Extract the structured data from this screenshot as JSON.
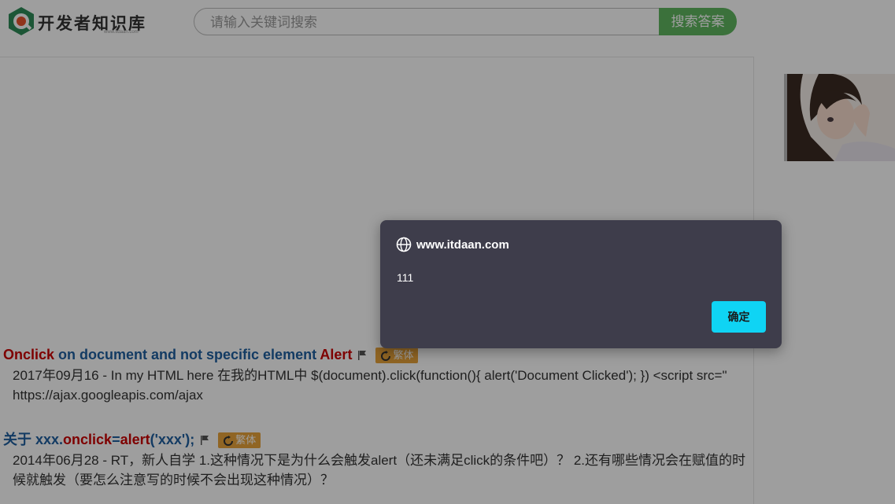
{
  "header": {
    "logo_text": "开发者知识库",
    "logo_sub": "www.itdaan.com",
    "search_placeholder": "请输入关键词搜索",
    "search_button": "搜索答案"
  },
  "results": [
    {
      "title_parts": [
        "Onclick",
        " on document and not specific element ",
        "Alert"
      ],
      "tag": "繁体",
      "snippet": "2017年09月16 - In my HTML here 在我的HTML中 $(document).click(function(){ alert('Document Clicked'); }) <script src=\" https://ajax.googleapis.com/ajax"
    },
    {
      "title_parts": [
        "关于 xxx.",
        "onclick",
        "=",
        "alert",
        "('xxx');"
      ],
      "tag": "繁体",
      "snippet": "2014年06月28 - RT，新人自学 1.这种情况下是为什么会触发alert（还未满足click的条件吧）？ 2.还有哪些情况会在赋值的时候就触发（要怎么注意写的时候不会出现这种情况）？"
    }
  ],
  "dialog": {
    "domain": "www.itdaan.com",
    "message": "111",
    "ok_button": "确定"
  },
  "colors": {
    "search_button": "#5fb760",
    "dialog_bg": "#3e3d4b",
    "dialog_button": "#0fd4f4",
    "tag": "#e8a33a"
  }
}
